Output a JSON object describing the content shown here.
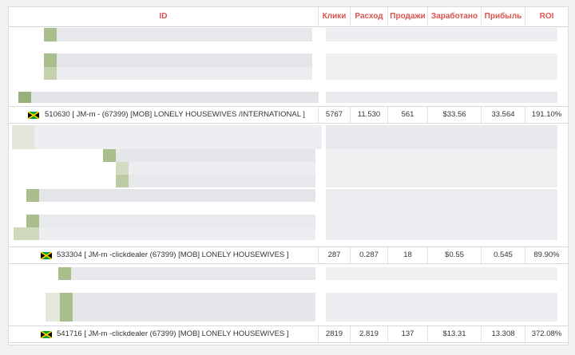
{
  "table": {
    "columns": {
      "id": "ID",
      "clicks": "Клики",
      "spend": "Расход",
      "sales": "Продажи",
      "earned": "Заработано",
      "profit": "Прибыль",
      "roi": "ROI"
    },
    "rows": [
      {
        "flag": "jamaica-flag-icon",
        "id_label": "510630 [ JM-m - (67399) [MOB] LONELY HOUSEWIVES /INTERNATIONAL ]",
        "clicks": "5767",
        "spend": "11.530",
        "sales": "561",
        "earned": "$33.56",
        "profit": "33.564",
        "roi": "191.10%"
      },
      {
        "flag": "jamaica-flag-icon",
        "id_label": "533304 [ JM-m -clickdealer (67399) [MOB] LONELY HOUSEWIVES ]",
        "clicks": "287",
        "spend": "0.287",
        "sales": "18",
        "earned": "$0.55",
        "profit": "0.545",
        "roi": "89.90%"
      },
      {
        "flag": "jamaica-flag-icon",
        "id_label": "541716 [ JM-m -clickdealer (67399) [MOB] LONELY HOUSEWIVES ]",
        "clicks": "2819",
        "spend": "2.819",
        "sales": "137",
        "earned": "$13.31",
        "profit": "13.308",
        "roi": "372.08%"
      }
    ]
  },
  "colors": {
    "header_text": "#d9534f",
    "blur_gray": "#e4e6ea",
    "blur_green": "#a9be8a",
    "flag_green": "#009b3a",
    "flag_gold": "#fed100"
  }
}
